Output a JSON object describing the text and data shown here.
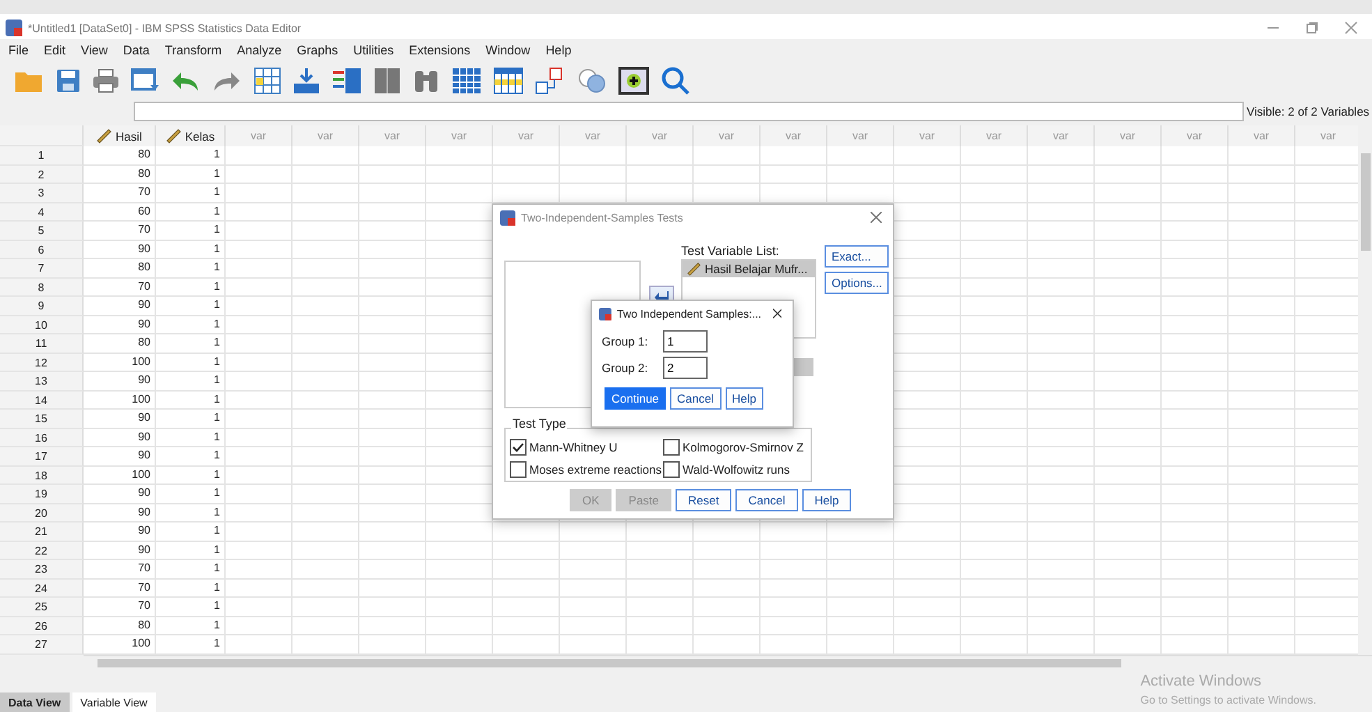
{
  "window": {
    "title": "*Untitled1 [DataSet0] - IBM SPSS Statistics Data Editor"
  },
  "menu": [
    "File",
    "Edit",
    "View",
    "Data",
    "Transform",
    "Analyze",
    "Graphs",
    "Utilities",
    "Extensions",
    "Window",
    "Help"
  ],
  "visible_label": "Visible: 2 of 2 Variables",
  "grid": {
    "columns": [
      {
        "label": "Hasil",
        "kind": "variable"
      },
      {
        "label": "Kelas",
        "kind": "variable"
      },
      {
        "label": "var",
        "kind": "empty"
      },
      {
        "label": "var",
        "kind": "empty"
      },
      {
        "label": "var",
        "kind": "empty"
      },
      {
        "label": "var",
        "kind": "empty"
      },
      {
        "label": "var",
        "kind": "empty"
      },
      {
        "label": "var",
        "kind": "empty"
      },
      {
        "label": "var",
        "kind": "empty"
      },
      {
        "label": "var",
        "kind": "empty"
      },
      {
        "label": "var",
        "kind": "empty"
      },
      {
        "label": "var",
        "kind": "empty"
      },
      {
        "label": "var",
        "kind": "empty"
      },
      {
        "label": "var",
        "kind": "empty"
      },
      {
        "label": "var",
        "kind": "empty"
      },
      {
        "label": "var",
        "kind": "empty"
      },
      {
        "label": "var",
        "kind": "empty"
      },
      {
        "label": "var",
        "kind": "empty"
      },
      {
        "label": "var",
        "kind": "empty"
      }
    ],
    "rows": [
      {
        "number": "1",
        "cells": [
          "80",
          "1"
        ]
      },
      {
        "number": "2",
        "cells": [
          "80",
          "1"
        ]
      },
      {
        "number": "3",
        "cells": [
          "70",
          "1"
        ]
      },
      {
        "number": "4",
        "cells": [
          "60",
          "1"
        ]
      },
      {
        "number": "5",
        "cells": [
          "70",
          "1"
        ]
      },
      {
        "number": "6",
        "cells": [
          "90",
          "1"
        ]
      },
      {
        "number": "7",
        "cells": [
          "80",
          "1"
        ]
      },
      {
        "number": "8",
        "cells": [
          "70",
          "1"
        ]
      },
      {
        "number": "9",
        "cells": [
          "90",
          "1"
        ]
      },
      {
        "number": "10",
        "cells": [
          "90",
          "1"
        ]
      },
      {
        "number": "11",
        "cells": [
          "80",
          "1"
        ]
      },
      {
        "number": "12",
        "cells": [
          "100",
          "1"
        ]
      },
      {
        "number": "13",
        "cells": [
          "90",
          "1"
        ]
      },
      {
        "number": "14",
        "cells": [
          "100",
          "1"
        ]
      },
      {
        "number": "15",
        "cells": [
          "90",
          "1"
        ]
      },
      {
        "number": "16",
        "cells": [
          "90",
          "1"
        ]
      },
      {
        "number": "17",
        "cells": [
          "90",
          "1"
        ]
      },
      {
        "number": "18",
        "cells": [
          "100",
          "1"
        ]
      },
      {
        "number": "19",
        "cells": [
          "90",
          "1"
        ]
      },
      {
        "number": "20",
        "cells": [
          "90",
          "1"
        ]
      },
      {
        "number": "21",
        "cells": [
          "90",
          "1"
        ]
      },
      {
        "number": "22",
        "cells": [
          "90",
          "1"
        ]
      },
      {
        "number": "23",
        "cells": [
          "70",
          "1"
        ]
      },
      {
        "number": "24",
        "cells": [
          "70",
          "1"
        ]
      },
      {
        "number": "25",
        "cells": [
          "70",
          "1"
        ]
      },
      {
        "number": "26",
        "cells": [
          "80",
          "1"
        ]
      },
      {
        "number": "27",
        "cells": [
          "100",
          "1"
        ]
      }
    ]
  },
  "tabs": [
    {
      "label": "Data View",
      "selected": true
    },
    {
      "label": "Variable View",
      "selected": false
    }
  ],
  "dialog": {
    "title": "Two-Independent-Samples Tests",
    "test_variable_label": "Test Variable List:",
    "test_variables": [
      "Hasil Belajar Mufr..."
    ],
    "side_buttons": [
      "Exact...",
      "Options..."
    ],
    "test_type": {
      "title": "Test Type",
      "options": [
        {
          "label": "Mann-Whitney U",
          "checked": true
        },
        {
          "label": "Kolmogorov-Smirnov Z",
          "checked": false
        },
        {
          "label": "Moses extreme reactions",
          "checked": false
        },
        {
          "label": "Wald-Wolfowitz runs",
          "checked": false
        }
      ]
    },
    "buttons": [
      {
        "label": "OK",
        "disabled": true
      },
      {
        "label": "Paste",
        "disabled": true
      },
      {
        "label": "Reset",
        "disabled": false
      },
      {
        "label": "Cancel",
        "disabled": false
      },
      {
        "label": "Help",
        "disabled": false
      }
    ]
  },
  "subdialog": {
    "title": "Two Independent Samples:...",
    "fields": [
      {
        "label": "Group 1:",
        "value": "1"
      },
      {
        "label": "Group 2:",
        "value": "2"
      }
    ],
    "buttons": [
      {
        "label": "Continue",
        "default": true
      },
      {
        "label": "Cancel",
        "default": false
      },
      {
        "label": "Help",
        "default": false
      }
    ]
  },
  "activation": {
    "title": "Activate Windows",
    "subtitle": "Go to Settings to activate Windows."
  }
}
